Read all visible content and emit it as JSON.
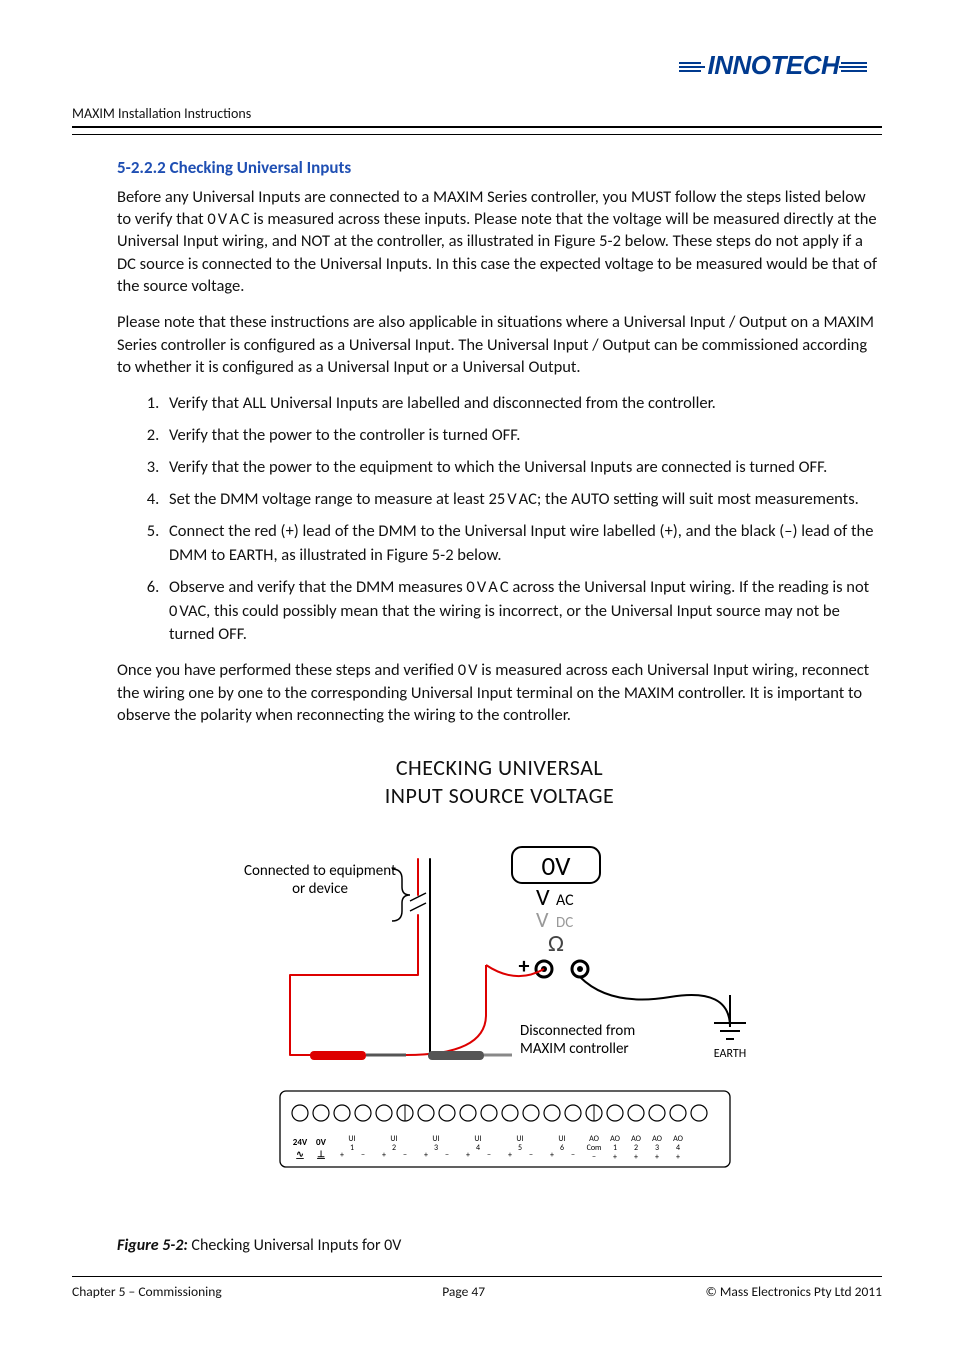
{
  "header": {
    "doc_title": "MAXIM Installation Instructions",
    "brand": "INNOTECH"
  },
  "section": {
    "number": "5-2.2.2",
    "title": "Checking Universal Inputs",
    "para1": "Before any Universal Inputs are connected to a MAXIM Series controller, you MUST follow the steps listed below to verify that 0 V A C  is measured across these inputs.  Please note that the voltage will be measured directly at the Universal Input wiring, and NOT at the controller, as illustrated in Figure 5-2 below.  These steps do not apply if a DC source is connected to the Universal Inputs.  In this case the expected voltage to be measured would be that of the source voltage.",
    "para2": "Please note that these instructions are also applicable in situations where a Universal Input / Output on a MAXIM Series controller is configured as a Universal Input.  The Universal Input / Output can be commissioned according to whether it is configured as a Universal Input or a Universal Output.",
    "steps": [
      "Verify that ALL Universal Inputs are labelled and disconnected from the controller.",
      "Verify that the power to the controller is turned OFF.",
      "Verify that the power to the equipment to which the Universal Inputs are connected is turned OFF.",
      "Set the DMM voltage range to measure at least 25 V AC; the AUTO setting will suit most measurements.",
      "Connect the red (+) lead of the DMM to the Universal Input wire labelled (+), and the black (–) lead of the DMM to EARTH, as illustrated in Figure 5-2 below.",
      "Observe and verify that the DMM measures 0 V A C  across the Universal Input wiring.  If the reading is not 0 VAC, this could possibly mean that the wiring is incorrect, or the Universal Input source may not be turned OFF."
    ],
    "para3": "Once you have performed these steps and verified 0 V is measured across each Universal Input wiring, reconnect the wiring one by one to the corresponding Universal Input terminal on the MAXIM controller.  It is important to observe the polarity when reconnecting the wiring to the controller."
  },
  "figure": {
    "title_line1": "CHECKING UNIVERSAL",
    "title_line2": "INPUT SOURCE VOLTAGE",
    "label_equipment_l1": "Connected to equipment",
    "label_equipment_l2": "or device",
    "label_disconnected_l1": "Disconnected from",
    "label_disconnected_l2": "MAXIM controller",
    "label_earth": "EARTH",
    "meter_reading": "0V",
    "meter_vac_v": "V",
    "meter_vac_ac": "AC",
    "meter_vdc_v": "V",
    "meter_vdc_dc": "DC",
    "meter_ohm": "Ω",
    "meter_plus": "+",
    "terminals": {
      "power": [
        "24V",
        "0V"
      ],
      "power_sym": [
        "∿",
        "⊥"
      ],
      "ui": [
        "UI 1",
        "UI 2",
        "UI 3",
        "UI 4",
        "UI 5",
        "UI 6"
      ],
      "ui_sym": [
        "+",
        "−"
      ],
      "ao_com": "AO Com",
      "ao_com_sym": "−",
      "ao": [
        "AO 1",
        "AO 2",
        "AO 3",
        "AO 4"
      ],
      "ao_sym": "+"
    },
    "caption_label": "Figure 5-2:",
    "caption_text": "   Checking Universal Inputs for 0V"
  },
  "footer": {
    "left": "Chapter 5 – Commissioning",
    "center": "Page 47",
    "right": "© Mass Electronics Pty Ltd  2011"
  }
}
